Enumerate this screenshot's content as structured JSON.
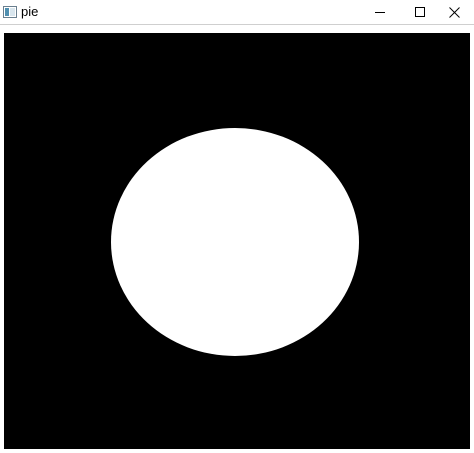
{
  "window": {
    "title": "pie",
    "icon": "app-window-icon",
    "controls": {
      "minimize_icon": "minimize-icon",
      "maximize_icon": "maximize-icon",
      "close_icon": "close-icon"
    }
  },
  "canvas": {
    "background_color": "#000000",
    "shape": {
      "kind": "filled-ellipse",
      "color": "#ffffff"
    }
  }
}
